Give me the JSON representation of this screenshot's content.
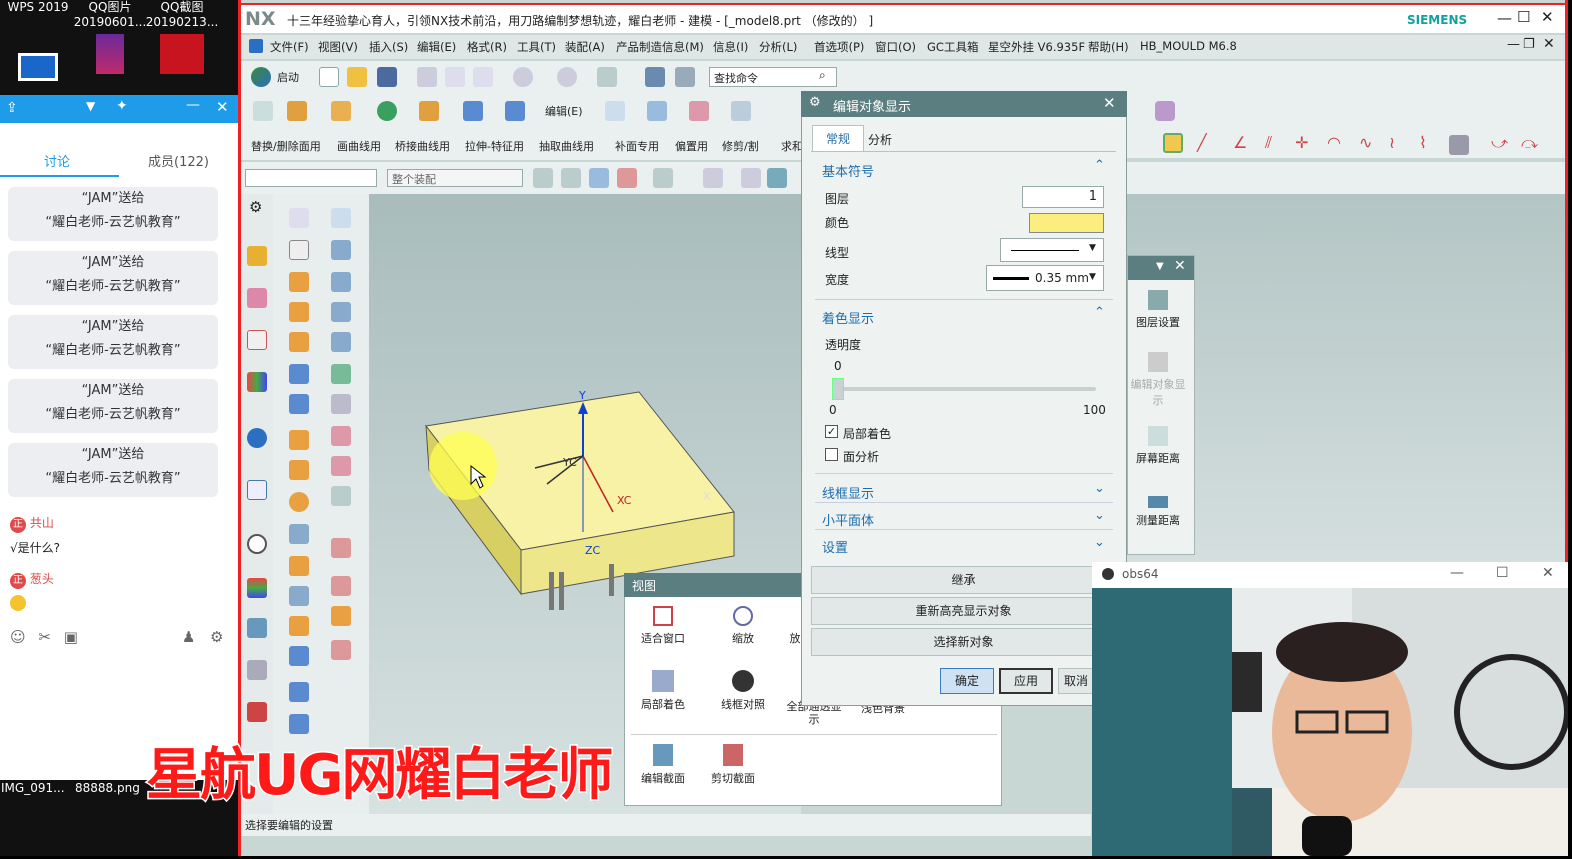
{
  "desktop": {
    "icons": [
      {
        "label1": "WPS 2019",
        "label2": ""
      },
      {
        "label1": "QQ图片",
        "label2": "20190601..."
      },
      {
        "label1": "QQ截图",
        "label2": "20190213..."
      }
    ],
    "bottom_files": [
      "IMG_091...",
      "88888.png"
    ]
  },
  "qq_chat": {
    "tabs": [
      "讨论",
      "成员(122)"
    ],
    "gift_messages": [
      {
        "line1": "“JAM”送给",
        "line2": "“耀白老师-云艺帆教育”"
      },
      {
        "line1": "“JAM”送给",
        "line2": "“耀白老师-云艺帆教育”"
      },
      {
        "line1": "“JAM”送给",
        "line2": "“耀白老师-云艺帆教育”"
      },
      {
        "line1": "“JAM”送给",
        "line2": "“耀白老师-云艺帆教育”"
      },
      {
        "line1": "“JAM”送给",
        "line2": "“耀白老师-云艺帆教育”"
      }
    ],
    "messages": [
      {
        "user": "共山",
        "badge": "正",
        "text": "√是什么?"
      },
      {
        "user": "葱头",
        "badge": "正",
        "text": ""
      }
    ]
  },
  "nx": {
    "logo": "NX",
    "title": "十三年经验挚心育人，引领NX技术前沿，用刀路编制梦想轨迹，耀白老师 - 建模 - [_model8.prt （修改的） ]",
    "brand": "SIEMENS",
    "menu": [
      "文件(F)",
      "视图(V)",
      "插入(S)",
      "编辑(E)",
      "格式(R)",
      "工具(T)",
      "装配(A)",
      "产品制造信息(M)",
      "信息(I)",
      "分析(L)",
      "首选项(P)",
      "窗口(O)",
      "GC工具箱",
      "星空外挂 V6.935F",
      "帮助(H)",
      "HB_MOULD M6.8"
    ],
    "start_label": "启动",
    "search_placeholder": "查找命令",
    "toolbar_row2_label": "编辑(E)",
    "toolbar_row3": [
      "替换/删除面用",
      "画曲线用",
      "桥接曲线用",
      "拉伸-特征用",
      "抽取曲线用",
      "补面专用",
      "偏置用",
      "修剪/割",
      "求和"
    ],
    "selection_filter": "",
    "assembly_scope": "整个装配",
    "status_text": "选择要编辑的设置",
    "axis_labels": {
      "y": "Y",
      "yc": "YC",
      "xc": "XC",
      "zc": "ZC",
      "x": "X"
    }
  },
  "edit_display_dialog": {
    "title": "编辑对象显示",
    "tabs": [
      "常规",
      "分析"
    ],
    "basic_section": "基本符号",
    "layer_label": "图层",
    "layer_value": "1",
    "color_label": "颜色",
    "color_value": "#fbee7e",
    "linetype_label": "线型",
    "width_label": "宽度",
    "width_value": "0.35 mm",
    "shading_section": "着色显示",
    "transparency_label": "透明度",
    "transparency_value": "0",
    "slider_min": "0",
    "slider_max": "100",
    "local_shading_label": "局部着色",
    "local_shading_checked": true,
    "face_analysis_label": "面分析",
    "face_analysis_checked": false,
    "wireframe_section": "线框显示",
    "facet_section": "小平面体",
    "settings_section": "设置",
    "inherit_btn": "继承",
    "rehighlight_btn": "重新高亮显示对象",
    "reselect_btn": "选择新对象",
    "ok_btn": "确定",
    "apply_btn": "应用",
    "cancel_btn": "取消"
  },
  "view_popup": {
    "title": "视图",
    "buttons": [
      "适合窗口",
      "缩放",
      "放",
      "局部着色",
      "线框对照",
      "全部通透显示",
      "浅色背景",
      "编辑截面",
      "剪切截面"
    ]
  },
  "side_panel": {
    "items": [
      "图层设置",
      "编辑对象显示",
      "屏幕距离",
      "测量距离"
    ]
  },
  "webcam": {
    "title": "obs64"
  },
  "watermark": "星航UG网耀白老师"
}
